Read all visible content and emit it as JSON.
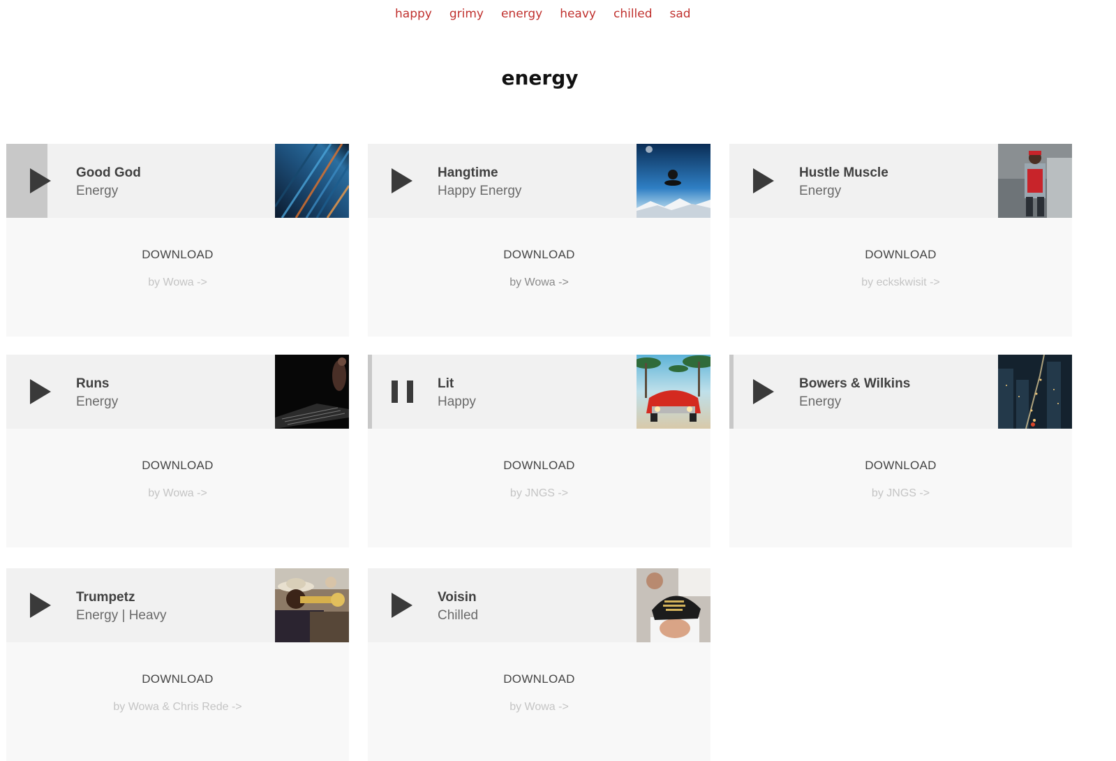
{
  "nav": {
    "links": [
      "happy",
      "grimy",
      "energy",
      "heavy",
      "chilled",
      "sad"
    ]
  },
  "page": {
    "heading": "energy"
  },
  "download_label": "DOWNLOAD",
  "colors": {
    "accent": "#c0312e",
    "player_bg": "#f1f1f1",
    "card_bg": "#f8f8f8"
  },
  "tracks": [
    {
      "title": "Good God",
      "genre": "Energy",
      "artist": "by Wowa ->",
      "state": "play",
      "progress": 0.12
    },
    {
      "title": "Hangtime",
      "genre": "Happy Energy",
      "artist": "by Wowa ->",
      "state": "play",
      "progress": 0
    },
    {
      "title": "Hustle Muscle",
      "genre": "Energy",
      "artist": "by eckskwisit ->",
      "state": "play",
      "progress": 0
    },
    {
      "title": "Runs",
      "genre": "Energy",
      "artist": "by Wowa ->",
      "state": "play",
      "progress": 0
    },
    {
      "title": "Lit",
      "genre": "Happy",
      "artist": "by JNGS ->",
      "state": "pause",
      "progress": 0.01
    },
    {
      "title": "Bowers & Wilkins",
      "genre": "Energy",
      "artist": "by JNGS ->",
      "state": "play",
      "progress": 0.005
    },
    {
      "title": "Trumpetz",
      "genre": "Energy | Heavy",
      "artist": "by Wowa & Chris Rede ->",
      "state": "play",
      "progress": 0
    },
    {
      "title": "Voisin",
      "genre": "Chilled",
      "artist": "by Wowa ->",
      "state": "play",
      "progress": 0
    }
  ]
}
